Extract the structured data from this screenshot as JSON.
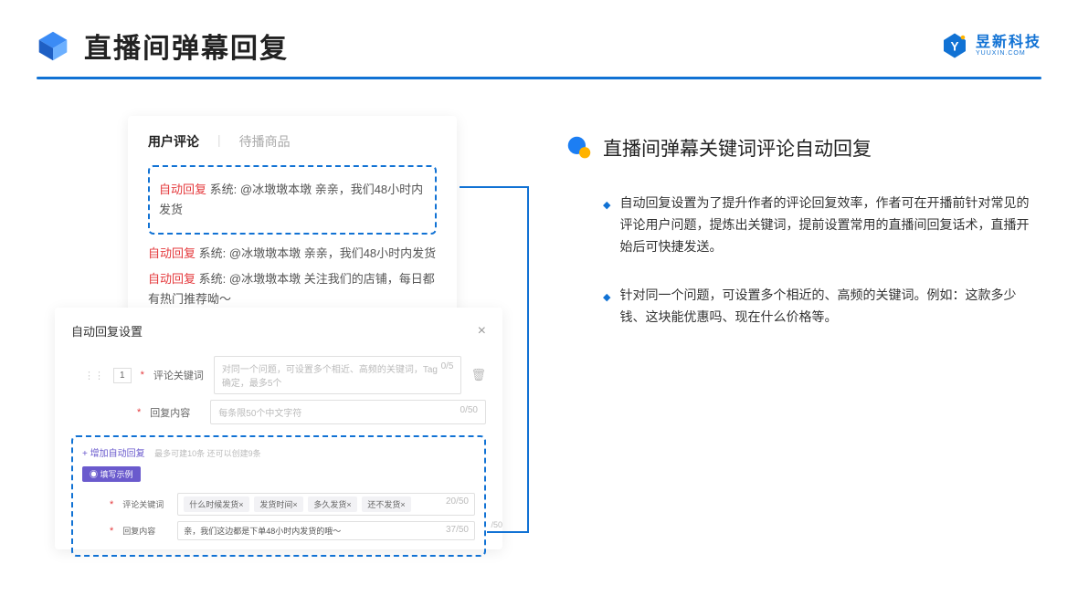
{
  "header": {
    "title": "直播间弹幕回复",
    "brand_main": "昱新科技",
    "brand_sub": "YUUXIN.COM"
  },
  "comments_card": {
    "tab_active": "用户评论",
    "tab_inactive": "待播商品",
    "reply_tag": "自动回复",
    "sys_prefix": "系统:",
    "highlighted": "@冰墩墩本墩 亲亲，我们48小时内发货",
    "line2": "@冰墩墩本墩 亲亲，我们48小时内发货",
    "line3": "@冰墩墩本墩 关注我们的店铺，每日都有热门推荐呦～"
  },
  "settings_card": {
    "title": "自动回复设置",
    "row_num": "1",
    "keyword_label": "评论关键词",
    "keyword_placeholder": "对同一个问题，可设置多个相近、高频的关键词，Tag确定，最多5个",
    "keyword_count": "0/5",
    "content_label": "回复内容",
    "content_placeholder": "每条限50个中文字符",
    "content_count": "0/50",
    "add_link": "+ 增加自动回复",
    "add_hint": "最多可建10条 还可以创建9条",
    "example_badge": "◉ 填写示例",
    "ex_keyword_label": "评论关键词",
    "ex_tags": [
      "什么时候发货×",
      "发货时间×",
      "多久发货×",
      "还不发货×"
    ],
    "ex_kw_count": "20/50",
    "ex_content_label": "回复内容",
    "ex_content": "亲，我们这边都是下单48小时内发货的哦～",
    "ex_content_count": "37/50",
    "side_count": "/50"
  },
  "right": {
    "heading": "直播间弹幕关键词评论自动回复",
    "bullet1": "自动回复设置为了提升作者的评论回复效率，作者可在开播前针对常见的评论用户问题，提炼出关键词，提前设置常用的直播间回复话术，直播开始后可快捷发送。",
    "bullet2": "针对同一个问题，可设置多个相近的、高频的关键词。例如：这款多少钱、这块能优惠吗、现在什么价格等。"
  }
}
